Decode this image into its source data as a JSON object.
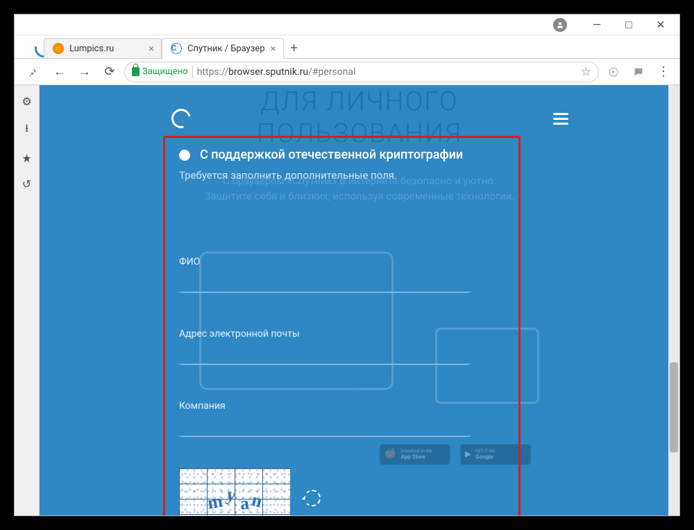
{
  "window": {
    "minimize": "—",
    "maximize": "□",
    "close": "✕"
  },
  "tabs": [
    {
      "title": "Lumpics.ru",
      "active": false
    },
    {
      "title": "Спутник / Браузер",
      "active": true
    }
  ],
  "newtab": "+",
  "toolbar": {
    "back": "←",
    "forward": "→",
    "reload": "⟳",
    "secure_label": "Защищено",
    "url_scheme": "https://",
    "url_host": "browser.sputnik.ru",
    "url_path": "/#personal",
    "star": "☆",
    "bolt": "⚡",
    "chat": "💬",
    "menu": "⋮",
    "pin": "📌"
  },
  "sidebar": {
    "settings": "⚙",
    "downloads": "⭳",
    "bookmarks": "★",
    "history": "↺"
  },
  "page": {
    "bg_title_line1": "ДЛЯ ЛИЧНОГО",
    "bg_title_line2": "ПОЛЬЗОВАНИЯ",
    "bg_sub_line1": "С браузером «Спутник» в интернете безопасно и уютно.",
    "bg_sub_line2": "Защитите себя и близких, используя современные технологии.",
    "radio_label": "С поддержкой отечественной криптографии",
    "sub_text": "Требуется заполнить дополнительные поля.",
    "field_fio_label": "ФИО",
    "field_fio_value": "",
    "field_email_label": "Адрес электронной почты",
    "field_email_value": "",
    "field_company_label": "Компания",
    "field_company_value": "",
    "captcha_chars": {
      "c1": "m",
      "c2": "y",
      "c3": "a",
      "c4": "n"
    },
    "appstore": "App Store",
    "google": "Google"
  }
}
